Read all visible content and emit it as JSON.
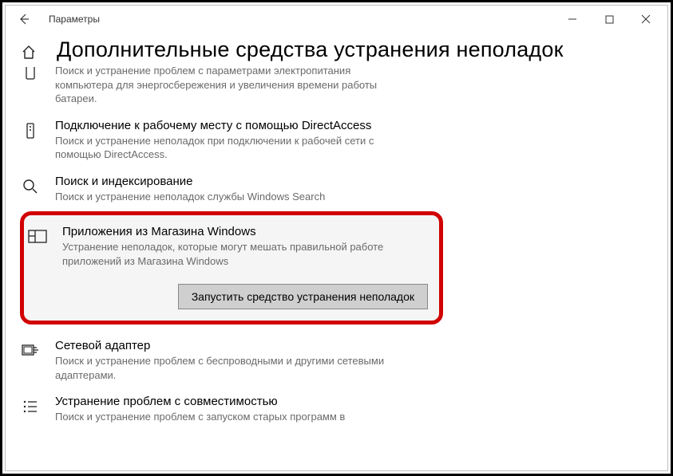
{
  "window": {
    "title": "Параметры"
  },
  "page": {
    "heading": "Дополнительные средства устранения неполадок"
  },
  "items": {
    "power": {
      "desc": "Поиск и устранение проблем с параметрами электропитания компьютера для энергосбережения и увеличения  времени работы батареи."
    },
    "directaccess": {
      "title": "Подключение к рабочему месту с помощью DirectAccess",
      "desc": "Поиск и устранение неполадок при подключении к рабочей сети с помощью DirectAccess."
    },
    "search": {
      "title": "Поиск и индексирование",
      "desc": "Поиск и устранение неполадок службы Windows Search"
    },
    "store": {
      "title": "Приложения из Магазина Windows",
      "desc": "Устранение неполадок, которые могут мешать правильной работе приложений из Магазина Windows",
      "run_label": "Запустить средство устранения неполадок"
    },
    "network": {
      "title": "Сетевой адаптер",
      "desc": "Поиск и устранение проблем с беспроводными и другими сетевыми адаптерами."
    },
    "compat": {
      "title": "Устранение проблем с совместимостью",
      "desc": "Поиск и устранение проблем с запуском старых программ в"
    }
  }
}
